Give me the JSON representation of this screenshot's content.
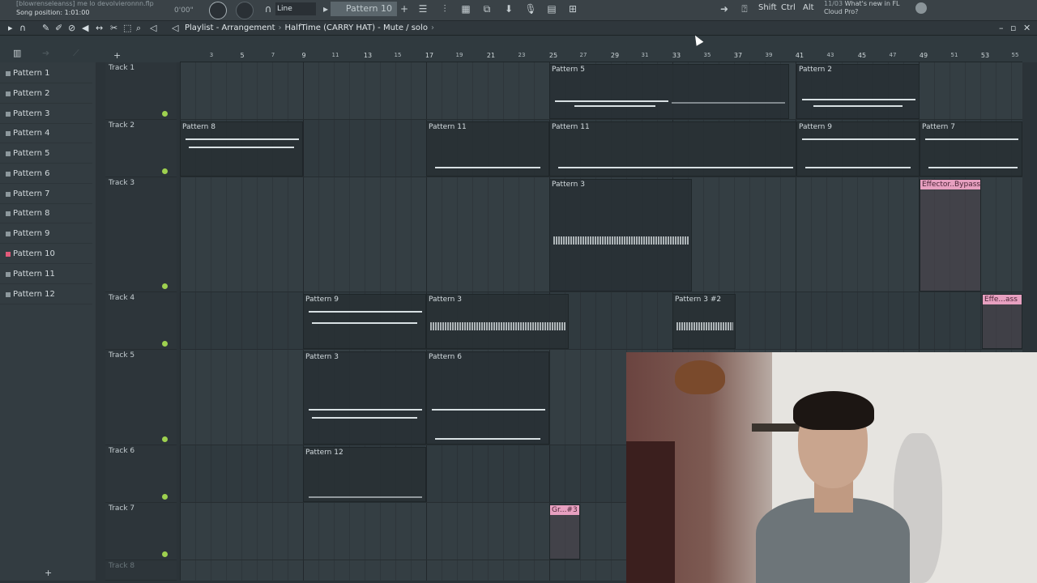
{
  "title_bar": {
    "project_file": "[blowrenseleanss] me lo devolvieronnn.flp",
    "song_position": "Song position: 1:01:00",
    "timer": "0'00\"",
    "snap_mode": "Line",
    "pattern_selector": "Pattern 10",
    "keys": [
      "Shift",
      "Ctrl",
      "Alt"
    ],
    "news_date": "11/03",
    "news_text": "What's new in FL",
    "news_text2": "Cloud Pro?"
  },
  "breadcrumb": {
    "window": "Playlist - Arrangement",
    "pattern": "HalfTime (CARRY HAT) - Mute / solo"
  },
  "ruler": {
    "bars_big": [
      "5",
      "9",
      "13",
      "17",
      "21",
      "25",
      "29",
      "33",
      "37",
      "41",
      "45",
      "49",
      "53"
    ],
    "bars_small": [
      "3",
      "7",
      "11",
      "15",
      "19",
      "23",
      "27",
      "31",
      "35",
      "39",
      "43",
      "47",
      "51",
      "55"
    ]
  },
  "picker": {
    "items": [
      {
        "label": "Pattern 1",
        "marked": false
      },
      {
        "label": "Pattern 2",
        "marked": false
      },
      {
        "label": "Pattern 3",
        "marked": false
      },
      {
        "label": "Pattern 4",
        "marked": false
      },
      {
        "label": "Pattern 5",
        "marked": false
      },
      {
        "label": "Pattern 6",
        "marked": false
      },
      {
        "label": "Pattern 7",
        "marked": false
      },
      {
        "label": "Pattern 8",
        "marked": false
      },
      {
        "label": "Pattern 9",
        "marked": false
      },
      {
        "label": "Pattern 10",
        "marked": true
      },
      {
        "label": "Pattern 11",
        "marked": false
      },
      {
        "label": "Pattern 12",
        "marked": false
      }
    ]
  },
  "tracks": [
    {
      "name": "Track 1"
    },
    {
      "name": "Track 2"
    },
    {
      "name": "Track 3"
    },
    {
      "name": "Track 4"
    },
    {
      "name": "Track 5"
    },
    {
      "name": "Track 6"
    },
    {
      "name": "Track 7"
    },
    {
      "name": "Track 8"
    }
  ],
  "clips": {
    "c1": "Pattern 5",
    "c2": "Pattern 2",
    "c3": "Pattern 8",
    "c4": "Pattern 11",
    "c5": "Pattern 11",
    "c6": "Pattern 9",
    "c7": "Pattern 7",
    "c8": "Pattern 3",
    "c9": "Effector..Bypass",
    "c10": "Pattern 9",
    "c11": "Pattern 3",
    "c12": "Pattern 3 #2",
    "c13": "Effe...ass",
    "c14": "Pattern 3",
    "c15": "Pattern 6",
    "c16": "Pattern 12",
    "c17": "Gr...#3"
  },
  "colors": {
    "track_dot": "#9ed14f",
    "automation_clip": "#e7a0c0",
    "marked_pattern": "#e25a7a"
  }
}
